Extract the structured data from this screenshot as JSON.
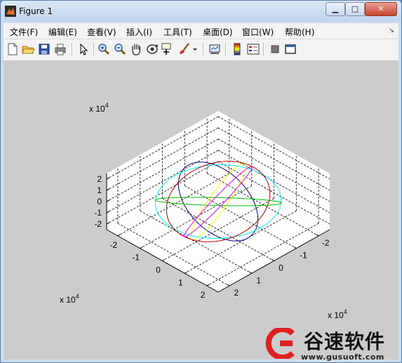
{
  "window": {
    "title": "Figure 1",
    "minimize_label": "▁",
    "maximize_label": "□",
    "close_label": "✕"
  },
  "menu": {
    "items": [
      {
        "label": "文件(F)"
      },
      {
        "label": "编辑(E)"
      },
      {
        "label": "查看(V)"
      },
      {
        "label": "插入(I)"
      },
      {
        "label": "工具(T)"
      },
      {
        "label": "桌面(D)"
      },
      {
        "label": "窗口(W)"
      },
      {
        "label": "帮助(H)"
      }
    ]
  },
  "toolbar": {
    "icons": [
      "new-figure-icon",
      "open-file-icon",
      "save-icon",
      "print-icon",
      "edit-plot-arrow-icon",
      "zoom-in-icon",
      "zoom-out-icon",
      "pan-hand-icon",
      "rotate-3d-icon",
      "data-cursor-icon",
      "brush-icon",
      "brush-dropdown-icon",
      "link-plot-icon",
      "colorbar-icon",
      "legend-icon",
      "hide-plot-tools-icon",
      "show-plot-tools-icon"
    ]
  },
  "chart_data": {
    "type": "line",
    "projection": "3d",
    "grid": true,
    "xlim": [
      -25000,
      25000
    ],
    "ylim": [
      -25000,
      25000
    ],
    "zlim": [
      -25000,
      25000
    ],
    "x_ticks": [
      -2,
      -1,
      0,
      1,
      2
    ],
    "y_ticks": [
      -2,
      -1,
      0,
      1,
      2
    ],
    "z_ticks": [
      -2,
      -1,
      0,
      1,
      2
    ],
    "x_exponent_label": "x 10",
    "y_exponent_label": "x 10",
    "z_exponent_label": "x 10",
    "exponent": "4",
    "radius": 20000,
    "series": [
      {
        "color": "#00008b",
        "normal": [
          0.55,
          -0.55,
          0.63
        ]
      },
      {
        "color": "#ffff00",
        "normal": [
          -0.82,
          0.45,
          0.35
        ]
      },
      {
        "color": "#00ffff",
        "normal": [
          0.0,
          0.1,
          1.0
        ]
      },
      {
        "color": "#00c000",
        "normal": [
          -0.6,
          -0.65,
          0.45
        ]
      },
      {
        "color": "#c00000",
        "normal": [
          0.85,
          0.05,
          0.5
        ]
      },
      {
        "color": "#ff00ff",
        "normal": [
          0.85,
          -0.3,
          -0.35
        ]
      }
    ]
  },
  "watermark": {
    "name": "谷速软件",
    "url": "www.gusuoft.com"
  }
}
